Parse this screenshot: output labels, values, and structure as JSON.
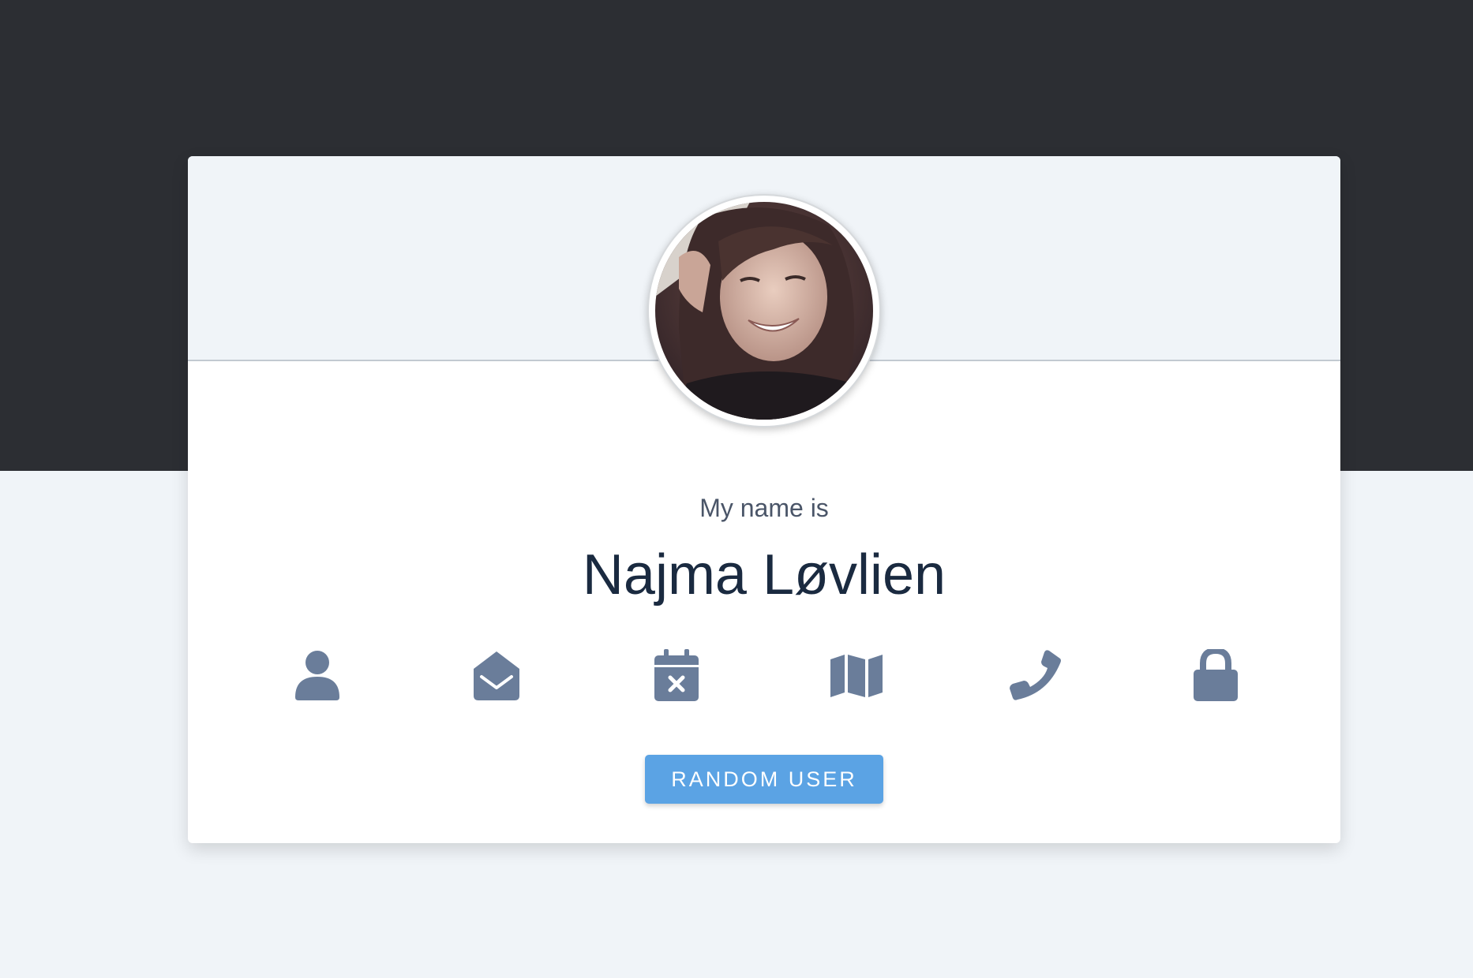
{
  "profile": {
    "intro": "My name is",
    "name": "Najma Løvlien",
    "avatar_alt": "Najma Løvlien"
  },
  "icons": [
    "user-icon",
    "envelope-open-icon",
    "calendar-x-icon",
    "map-icon",
    "phone-icon",
    "lock-icon"
  ],
  "actions": {
    "random_user_label": "RANDOM USER"
  },
  "colors": {
    "dark_band": "#2c2e33",
    "page_background": "#f0f4f8",
    "card_background": "#ffffff",
    "icon": "#6a7d9a",
    "button": "#5ba3e4",
    "name_text": "#1a2a40",
    "intro_text": "#4a5568"
  }
}
